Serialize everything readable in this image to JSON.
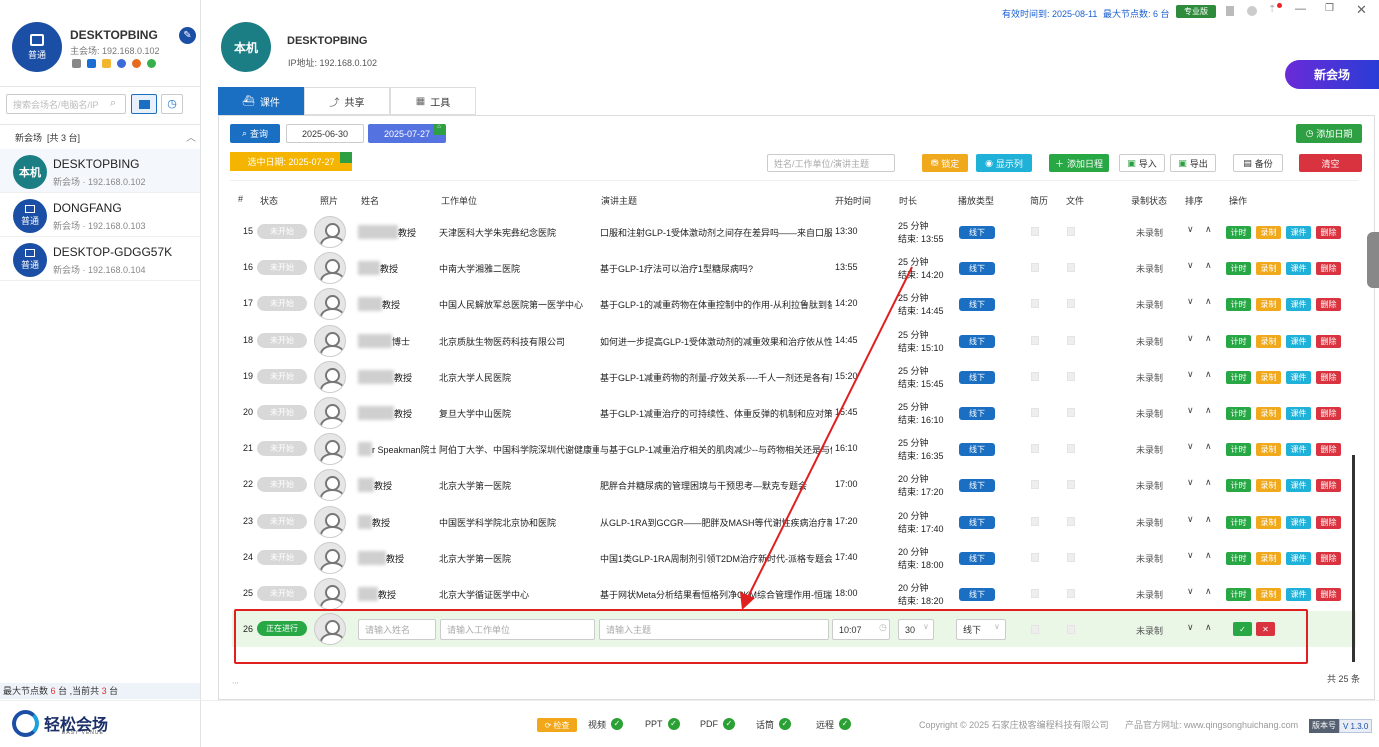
{
  "sidebar": {
    "host_name": "DESKTOPBING",
    "host_badge": "普通",
    "host_ip": "主会场: 192.168.0.102",
    "search_placeholder": "搜索会场名/电脑名/IP",
    "group_title": "新会场",
    "group_count": "[共 3 台]",
    "items": [
      {
        "avatar": "本机",
        "name": "DESKTOPBING",
        "sub": "新会场 · 192.168.0.102",
        "teal": true
      },
      {
        "avatar": "普通",
        "name": "DONGFANG",
        "sub": "新会场 · 192.168.0.103",
        "teal": false
      },
      {
        "avatar": "普通",
        "name": "DESKTOP-GDGG57K",
        "sub": "新会场 · 192.168.0.104",
        "teal": false
      }
    ],
    "footer_prefix": "最大节点数",
    "footer_max": "6",
    "footer_mid": "台 ,当前共",
    "footer_cur": "3",
    "footer_suffix": "台"
  },
  "header": {
    "expiry": "有效时间到: 2025-08-11",
    "max_nodes": "最大节点数: 6 台",
    "edition": "专业版",
    "local_avatar": "本机",
    "local_name": "DESKTOPBING",
    "local_ip": "IP地址: 192.168.0.102",
    "new_venue_button": "新会场"
  },
  "tabs": [
    {
      "label": "课件"
    },
    {
      "label": "共享"
    },
    {
      "label": "工具"
    }
  ],
  "toolbar": {
    "query": "查询",
    "date_from": "2025-06-30",
    "date_to": "2025-07-27",
    "add_date": "添加日期",
    "selected_date": "选中日期: 2025-07-27",
    "search_placeholder": "姓名/工作单位/演讲主题",
    "lock": "锁定",
    "show_cols": "显示列",
    "add_schedule": "添加日程",
    "import": "导入",
    "export": "导出",
    "backup": "备份",
    "clear": "清空"
  },
  "columns": [
    "#",
    "状态",
    "照片",
    "姓名",
    "工作单位",
    "演讲主题",
    "开始时间",
    "时长",
    "播放类型",
    "简历",
    "文件",
    "录制状态",
    "排序",
    "操作"
  ],
  "rows": [
    {
      "no": "15",
      "status": "未开始",
      "name": "教授",
      "unit": "天津医科大学朱宪彝纪念医院",
      "topic": "口服和注射GLP-1受体激动剂之间存在差异吗——来自口服G",
      "start": "13:30",
      "dur": "25 分钟",
      "end": "结束: 13:55",
      "type": "线下",
      "rec": "未录制"
    },
    {
      "no": "16",
      "status": "未开始",
      "name": "教授",
      "unit": "中南大学湘雅二医院",
      "topic": "基于GLP-1疗法可以治疗1型糖尿病吗?",
      "start": "13:55",
      "dur": "25 分钟",
      "end": "结束: 14:20",
      "type": "线下",
      "rec": "未录制"
    },
    {
      "no": "17",
      "status": "未开始",
      "name": "教授",
      "unit": "中国人民解放军总医院第一医学中心",
      "topic": "基于GLP-1的减重药物在体重控制中的作用-从利拉鲁肽到替尔",
      "start": "14:20",
      "dur": "25 分钟",
      "end": "结束: 14:45",
      "type": "线下",
      "rec": "未录制"
    },
    {
      "no": "18",
      "status": "未开始",
      "name": "博士",
      "unit": "北京质肽生物医药科技有限公司",
      "topic": "如何进一步提高GLP-1受体激动剂的减重效果和治疗依从性",
      "start": "14:45",
      "dur": "25 分钟",
      "end": "结束: 15:10",
      "type": "线下",
      "rec": "未录制"
    },
    {
      "no": "19",
      "status": "未开始",
      "name": "教授",
      "unit": "北京大学人民医院",
      "topic": "基于GLP-1减重药物的剂量-疗效关系----千人一剂还是各有所",
      "start": "15:20",
      "dur": "25 分钟",
      "end": "结束: 15:45",
      "type": "线下",
      "rec": "未录制"
    },
    {
      "no": "20",
      "status": "未开始",
      "name": "教授",
      "unit": "复旦大学中山医院",
      "topic": "基于GLP-1减重治疗的可持续性、体重反弹的机制和应对策略",
      "start": "15:45",
      "dur": "25 分钟",
      "end": "结束: 16:10",
      "type": "线下",
      "rec": "未录制"
    },
    {
      "no": "21",
      "status": "未开始",
      "name": "r Speakman院士",
      "unit": "阿伯丁大学、中国科学院深圳代谢健康重点",
      "topic": "与基于GLP-1减重治疗相关的肌肉减少--与药物相关还是与体",
      "start": "16:10",
      "dur": "25 分钟",
      "end": "结束: 16:35",
      "type": "线下",
      "rec": "未录制"
    },
    {
      "no": "22",
      "status": "未开始",
      "name": "教授",
      "unit": "北京大学第一医院",
      "topic": "肥胖合并糖尿病的管理困境与干预思考—默克专题会",
      "start": "17:00",
      "dur": "20 分钟",
      "end": "结束: 17:20",
      "type": "线下",
      "rec": "未录制"
    },
    {
      "no": "23",
      "status": "未开始",
      "name": "教授",
      "unit": "中国医学科学院北京协和医院",
      "topic": "从GLP-1RA到GCGR——肥胖及MASH等代谢性疾病治疗新着",
      "start": "17:20",
      "dur": "20 分钟",
      "end": "结束: 17:40",
      "type": "线下",
      "rec": "未录制"
    },
    {
      "no": "24",
      "status": "未开始",
      "name": "教授",
      "unit": "北京大学第一医院",
      "topic": "中国1类GLP-1RA周制剂引领T2DM治疗新时代-派格专题会",
      "start": "17:40",
      "dur": "20 分钟",
      "end": "结束: 18:00",
      "type": "线下",
      "rec": "未录制"
    },
    {
      "no": "25",
      "status": "未开始",
      "name": "教授",
      "unit": "北京大学循证医学中心",
      "topic": "基于网状Meta分析结果看恒格列净CKM综合管理作用-恒瑞专",
      "start": "18:00",
      "dur": "20 分钟",
      "end": "结束: 18:20",
      "type": "线下",
      "rec": "未录制"
    }
  ],
  "actions": {
    "time": "计时",
    "record": "录制",
    "ware": "课件",
    "delete": "删除"
  },
  "new_row": {
    "no": "26",
    "status": "正在进行",
    "name_placeholder": "请输入姓名",
    "unit_placeholder": "请输入工作单位",
    "topic_placeholder": "请输入主题",
    "start": "10:07",
    "dur": "30",
    "type": "线下",
    "rec": "未录制"
  },
  "total": "共 25 条",
  "footer": {
    "logo_text": "轻松会场",
    "logo_sub": "EASY VENUE",
    "check": "检查",
    "checks": [
      "视频",
      "PPT",
      "PDF",
      "话筒",
      "远程"
    ],
    "copyright": "Copyright © 2025 石家庄极客编程科技有限公司",
    "website": "产品官方网址: www.qingsonghuichang.com",
    "version_label": "版本号",
    "version": "V 1.3.0"
  },
  "colors": {
    "primary": "#1b6fc2",
    "green": "#28a745",
    "orange": "#f0a81c",
    "cyan": "#1fb1d8",
    "red": "#d8333f",
    "annotation": "#e02020"
  }
}
